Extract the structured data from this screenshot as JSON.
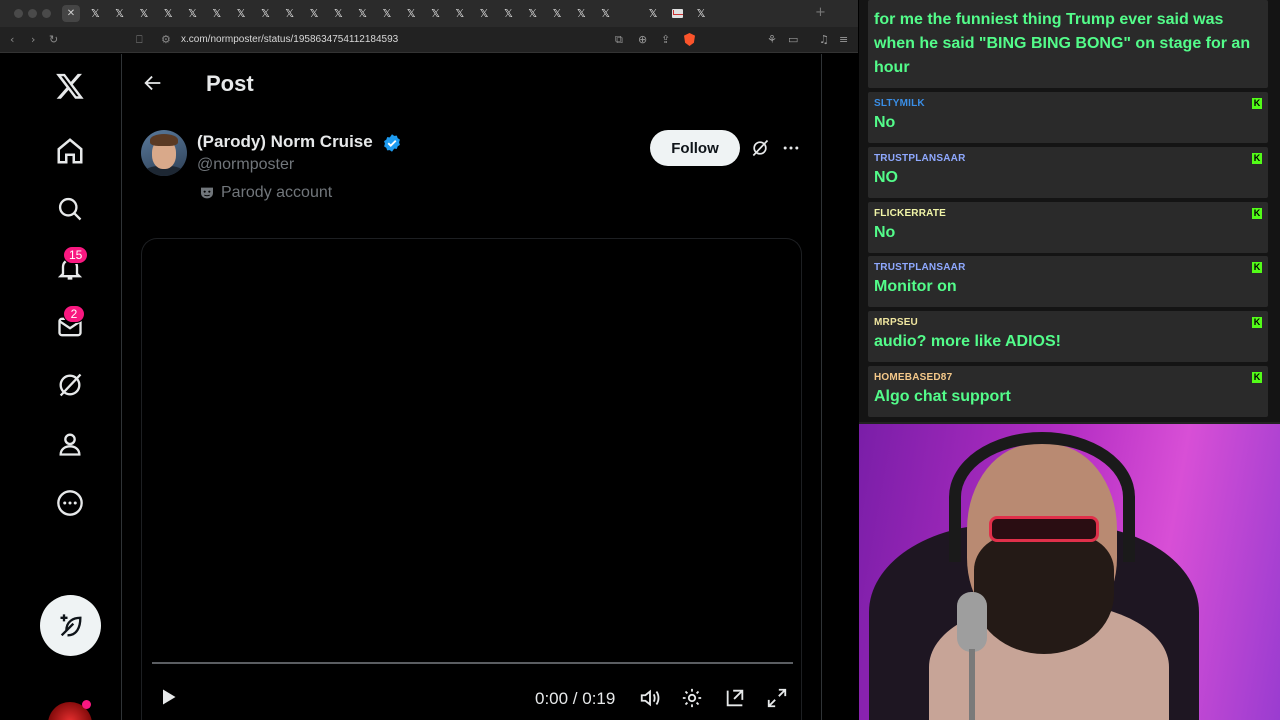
{
  "browser": {
    "url": "x.com/normposter/status/1958634754112184593",
    "tab_count": 26
  },
  "nav": {
    "notifications_badge": "15",
    "messages_badge": "2"
  },
  "post": {
    "header_title": "Post",
    "author_name": "(Parody) Norm Cruise",
    "author_handle": "@normposter",
    "parody_label": "Parody account",
    "follow_label": "Follow",
    "video": {
      "time": "0:00 / 0:19",
      "progress": 0
    }
  },
  "chat": {
    "top_message": "for me the funniest thing Trump ever said was when he said \"BING BING BONG\" on stage for an hour",
    "messages": [
      {
        "user": "SLTYMILK",
        "text": "No",
        "color": "#3a8ee6"
      },
      {
        "user": "TRUSTPLANSAAR",
        "text": "NO",
        "color": "#8fa9ff"
      },
      {
        "user": "FLICKERRATE",
        "text": "No",
        "color": "#f1f5a8"
      },
      {
        "user": "TRUSTPLANSAAR",
        "text": "Monitor on",
        "color": "#8fa9ff"
      },
      {
        "user": "MRPSEU",
        "text": "audio? more like ADIOS!",
        "color": "#f0e6a0"
      },
      {
        "user": "HOMEBASED87",
        "text": "Algo chat support",
        "color": "#f5c98a"
      }
    ],
    "badge_letter": "K",
    "accent_color": "#53fc8a"
  },
  "colors": {
    "x_blue": "#1d9bf0",
    "x_pink": "#f91880",
    "text_primary": "#e7e9ea",
    "text_secondary": "#71767b"
  }
}
